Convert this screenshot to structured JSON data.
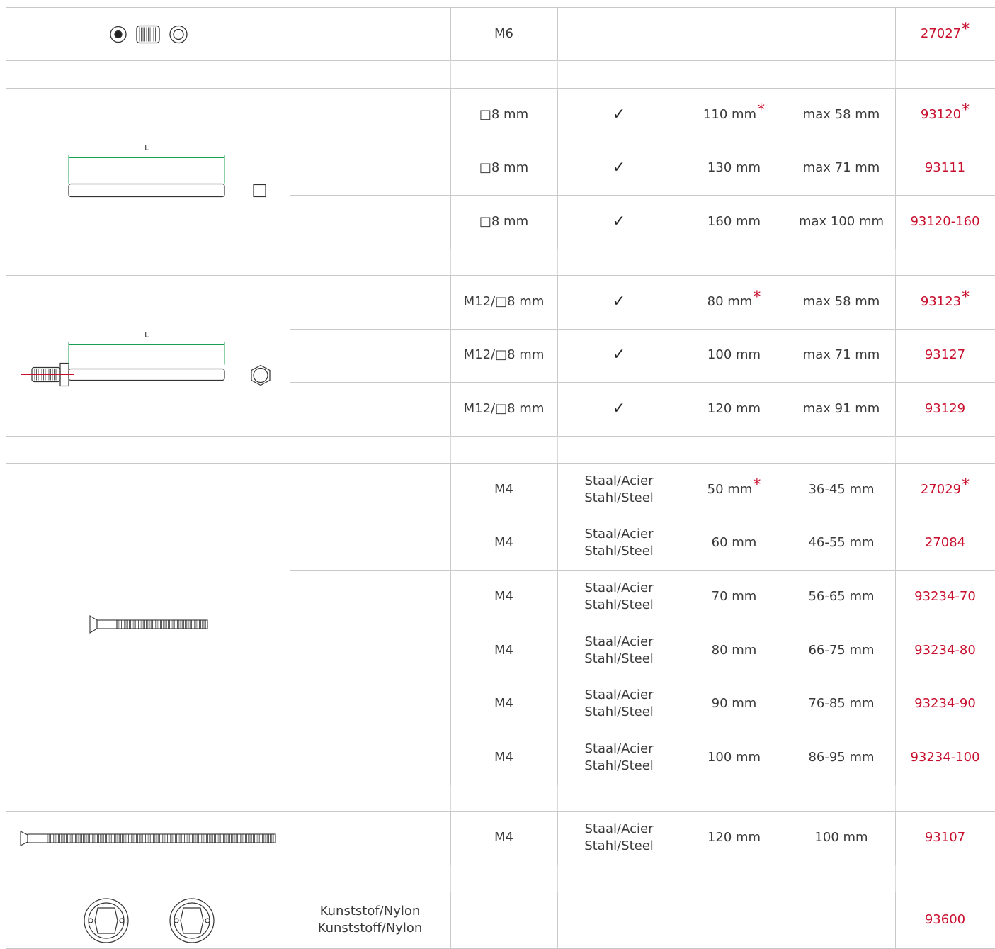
{
  "check_mark": "✓",
  "asterisk": "*",
  "materials": {
    "steel_line1": "Staal/Acier",
    "steel_line2": "Stahl/Steel",
    "nylon_line1": "Kunststof/Nylon",
    "nylon_line2": "Kunststoff/Nylon"
  },
  "drawings": {
    "length_label": "L"
  },
  "groups": [
    {
      "id": "set-screw",
      "rows": [
        {
          "thread": "M6",
          "check": "",
          "length": "",
          "length_ast": false,
          "range": "",
          "article": "27027",
          "article_ast": true
        }
      ]
    },
    {
      "id": "square-spindle",
      "rows": [
        {
          "thread": "□8 mm",
          "check": "✓",
          "length": "110 mm",
          "length_ast": true,
          "range": "max 58 mm",
          "article": "93120",
          "article_ast": true
        },
        {
          "thread": "□8 mm",
          "check": "✓",
          "length": "130 mm",
          "length_ast": false,
          "range": "max 71 mm",
          "article": "93111",
          "article_ast": false
        },
        {
          "thread": "□8 mm",
          "check": "✓",
          "length": "160 mm",
          "length_ast": false,
          "range": "max 100 mm",
          "article": "93120-160",
          "article_ast": false
        }
      ]
    },
    {
      "id": "threaded-spindle",
      "rows": [
        {
          "thread": "M12/□8 mm",
          "check": "✓",
          "length": "80 mm",
          "length_ast": true,
          "range": "max 58 mm",
          "article": "93123",
          "article_ast": true
        },
        {
          "thread": "M12/□8 mm",
          "check": "✓",
          "length": "100 mm",
          "length_ast": false,
          "range": "max 71 mm",
          "article": "93127",
          "article_ast": false
        },
        {
          "thread": "M12/□8 mm",
          "check": "✓",
          "length": "120 mm",
          "length_ast": false,
          "range": "max 91 mm",
          "article": "93129",
          "article_ast": false
        }
      ]
    },
    {
      "id": "screw-m4",
      "rows": [
        {
          "thread": "M4",
          "material": true,
          "length": "50 mm",
          "length_ast": true,
          "range": "36-45 mm",
          "article": "27029",
          "article_ast": true
        },
        {
          "thread": "M4",
          "material": true,
          "length": "60 mm",
          "length_ast": false,
          "range": "46-55 mm",
          "article": "27084",
          "article_ast": false
        },
        {
          "thread": "M4",
          "material": true,
          "length": "70 mm",
          "length_ast": false,
          "range": "56-65 mm",
          "article": "93234-70",
          "article_ast": false
        },
        {
          "thread": "M4",
          "material": true,
          "length": "80 mm",
          "length_ast": false,
          "range": "66-75 mm",
          "article": "93234-80",
          "article_ast": false
        },
        {
          "thread": "M4",
          "material": true,
          "length": "90 mm",
          "length_ast": false,
          "range": "76-85 mm",
          "article": "93234-90",
          "article_ast": false
        },
        {
          "thread": "M4",
          "material": true,
          "length": "100 mm",
          "length_ast": false,
          "range": "86-95 mm",
          "article": "93234-100",
          "article_ast": false
        }
      ]
    },
    {
      "id": "screw-long",
      "rows": [
        {
          "thread": "M4",
          "material": true,
          "length": "120 mm",
          "length_ast": false,
          "range": "100 mm",
          "article": "93107",
          "article_ast": false
        }
      ]
    },
    {
      "id": "nylon-rosette",
      "rows": [
        {
          "nylon": true,
          "thread": "",
          "length": "",
          "length_ast": false,
          "range": "",
          "article": "93600",
          "article_ast": false
        }
      ]
    }
  ]
}
